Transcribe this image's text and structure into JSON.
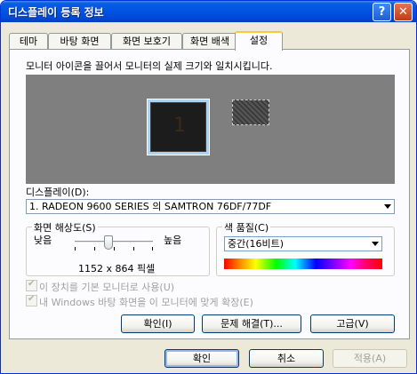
{
  "window": {
    "title": "디스플레이 등록 정보",
    "help_symbol": "?",
    "close_symbol": "✕"
  },
  "tabs": [
    "테마",
    "바탕 화면",
    "화면 보호기",
    "화면 배색",
    "설정"
  ],
  "settings": {
    "instruction": "모니터 아이콘을 끌어서 모니터의 실제 크기와 일치시킵니다.",
    "monitor_number": "1",
    "display_label": "디스플레이(D):",
    "display_value": "1. RADEON 9600 SERIES      의 SAMTRON 76DF/77DF",
    "resolution": {
      "group_label": "화면 해상도(S)",
      "low": "낮음",
      "high": "높음",
      "value": "1152 x 864 픽셀",
      "slider_position": 0.43
    },
    "color_quality": {
      "group_label": "색 품질(C)",
      "value": "중간(16비트)"
    },
    "checkbox_primary": "이 장치를 기본 모니터로 사용(U)",
    "checkbox_extend": "내 Windows 바탕 화면을 이 모니터에 맞게 확장(E)",
    "buttons": {
      "identify": "확인(I)",
      "troubleshoot": "문제 해결(T)...",
      "advanced": "고급(V)"
    }
  },
  "dialog_buttons": {
    "ok": "확인",
    "cancel": "취소",
    "apply": "적용(A)"
  },
  "colors": {
    "title_blue": "#0055e5",
    "dialog_bg": "#ece9d8",
    "panel_bg": "#fcfcfe",
    "preview_gray": "#7f7f7f"
  }
}
